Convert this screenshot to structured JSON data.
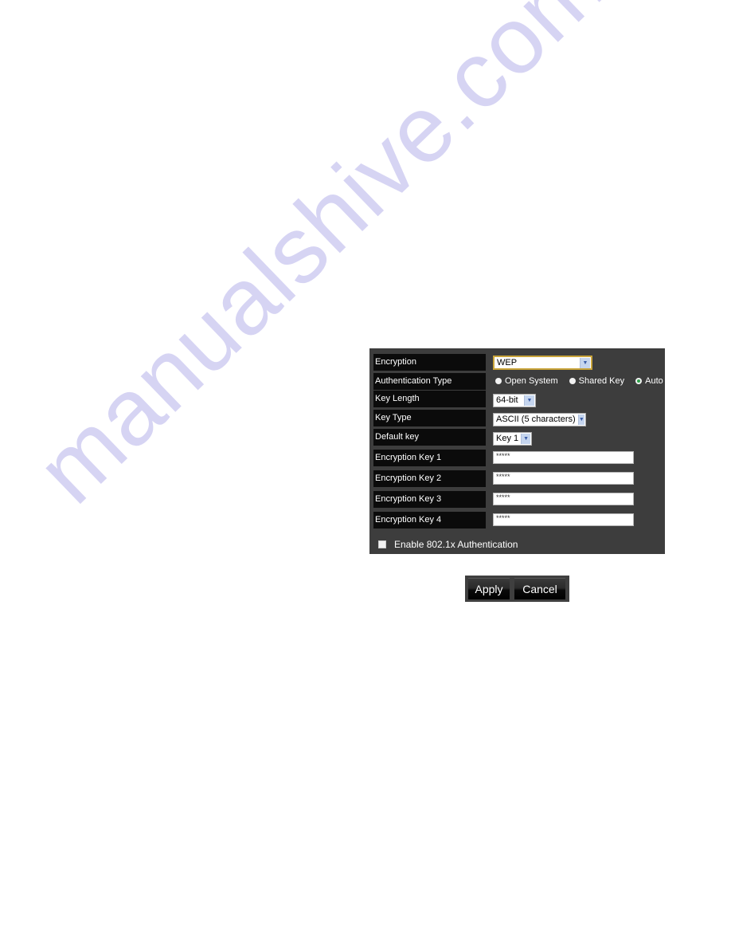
{
  "watermark": "manualshive.com",
  "form": {
    "encryption": {
      "label": "Encryption",
      "value": "WEP"
    },
    "authentication_type": {
      "label": "Authentication Type",
      "options": [
        {
          "label": "Open System",
          "selected": false
        },
        {
          "label": "Shared Key",
          "selected": false
        },
        {
          "label": "Auto",
          "selected": true
        }
      ]
    },
    "key_length": {
      "label": "Key Length",
      "value": "64-bit"
    },
    "key_type": {
      "label": "Key Type",
      "value": "ASCII (5 characters)"
    },
    "default_key": {
      "label": "Default key",
      "value": "Key 1"
    },
    "keys": [
      {
        "label": "Encryption Key 1",
        "value": "*****"
      },
      {
        "label": "Encryption Key 2",
        "value": "*****"
      },
      {
        "label": "Encryption Key 3",
        "value": "*****"
      },
      {
        "label": "Encryption Key 4",
        "value": "*****"
      }
    ],
    "enable_8021x": {
      "label": "Enable 802.1x Authentication",
      "checked": false
    }
  },
  "buttons": {
    "apply": "Apply",
    "cancel": "Cancel"
  },
  "icons": {
    "dropdown": "chevron-down-icon"
  },
  "colors": {
    "panel_bg": "#3d3d3d",
    "label_bg": "#0b0b0b",
    "focus_border": "#c9a43a",
    "radio_selected": "#2fa14a"
  }
}
